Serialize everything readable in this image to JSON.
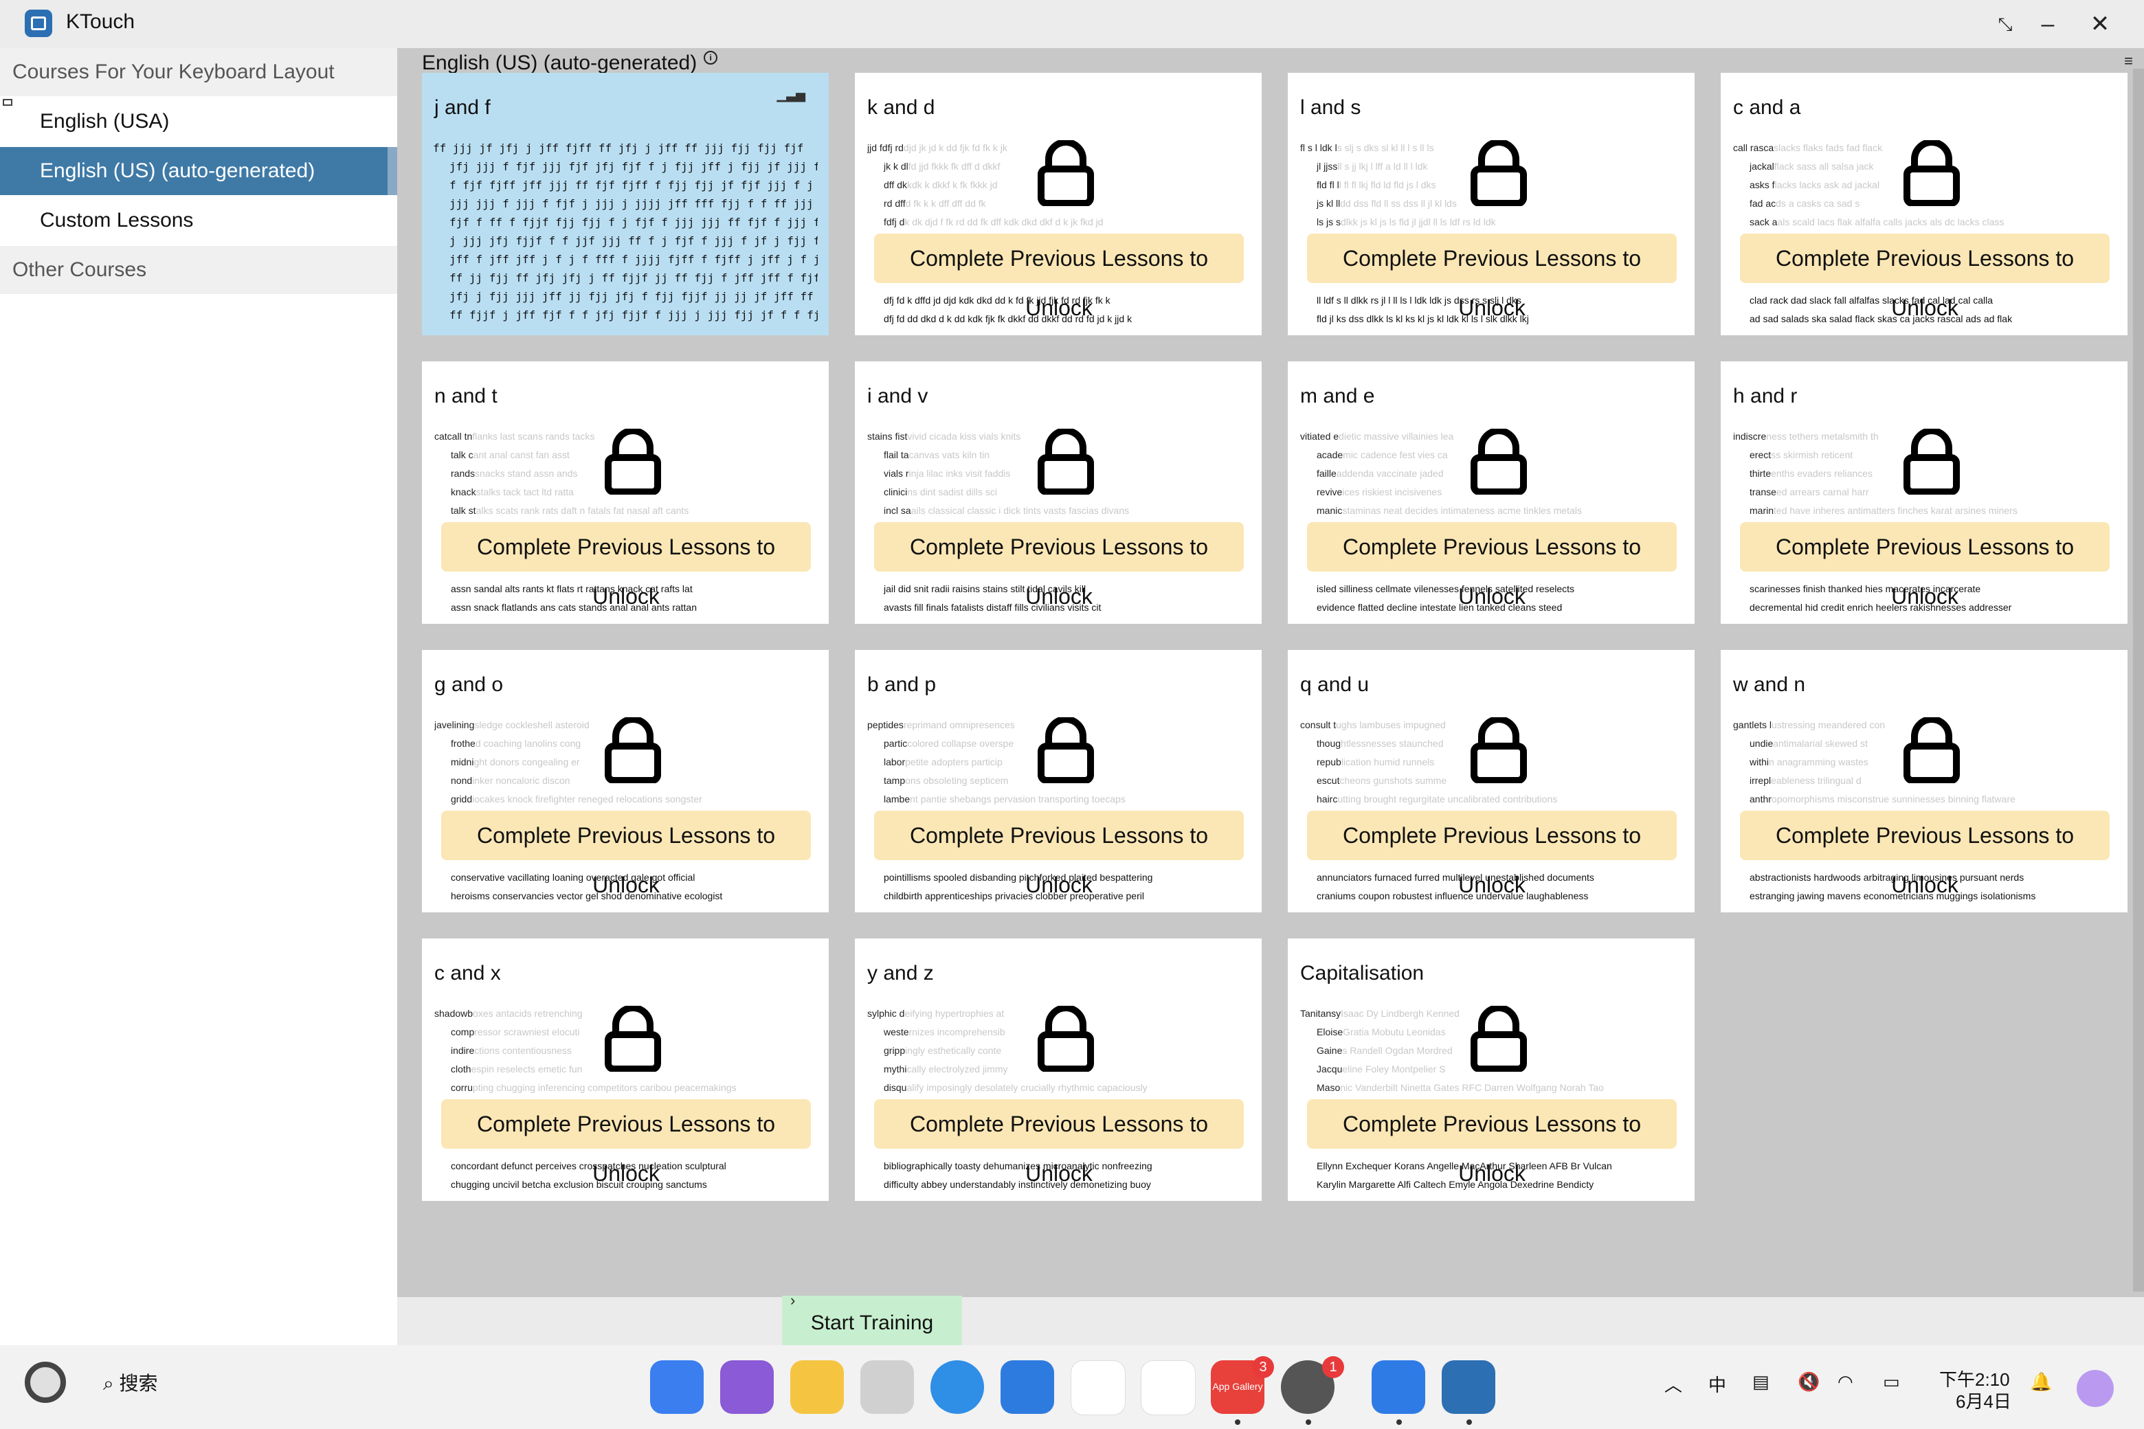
{
  "window": {
    "title": "KTouch"
  },
  "sidebar": {
    "header1": "Courses For Your Keyboard Layout",
    "items": [
      {
        "label": "English (USA)"
      },
      {
        "label": "English (US) (auto-generated)"
      },
      {
        "label": "Custom Lessons"
      }
    ],
    "header2": "Other Courses"
  },
  "main": {
    "course_title": "English (US) (auto-generated)",
    "unlock_label": "Complete Previous Lessons to Unlock",
    "start_training": "Start Training"
  },
  "lessons": [
    {
      "title": "j and f",
      "status": "unlocked",
      "lines": [
        "ff jjj jf jfj j jff fjff ff jfj j jff ff jjj fjj fjj fjf",
        "jfj jjj f fjf jjj fjf jfj fjf f j fjj jff j fjj jf jjj fjjf f",
        "f fjf fjff jff jjj ff fjf fjff f fjj fjj jf fjf jjj f j fjj",
        "jjj jjj f jjj f fjf j jjj j jjjj jff fff fjj f f ff jjj j",
        "fjf f ff f fjjf fjj fjj f j fjf f jjj jjj ff fjf f jjj fjj",
        "j jjj jfj fjjf f f jjf jjj ff f j fjf f jjj f jf j fjj fjjf jj",
        "jff f jff jff j f j f fff f jjjj fjff f fjff j jff j f jf j",
        "ff jj fjj ff jfj jfj j ff fjjf jj ff fjj f jff jff f fjf jj jf",
        "jfj j fjj jjj jff jj fjj jfj f fjj fjjf jj jj jf jff ff f jf jj",
        "ff fjjf j jff fjf f f jfj fjjf f jjj j jjj fjj jf f f fjj ff jjj"
      ]
    },
    {
      "title": "k and d",
      "status": "locked",
      "lead": [
        "jjd fdfj rd",
        "jk k dl",
        "dff dk",
        "rd dff",
        "fdfj d"
      ],
      "dim": [
        "djd jk jd k dd fjk fd fk k jk",
        "fd jjd fkkk fk dff d dkkf",
        "kdk k dkkf k fk fkkk jd",
        "d fk k k dff dff dd fk",
        "k dk djd f fk rd dd fk dff kdk dkd dkf d k jk fkd jd"
      ],
      "footer": [
        "dfj fd k dffd jd djd kdk dkd dd k fd fk jjd fjk fd rd fjk fk k",
        "dfj fd dd dkd d k dd kdk fjk fk dkkf dd dkkf dd rd fd jd k jjd k"
      ]
    },
    {
      "title": "l and s",
      "status": "locked",
      "lead": [
        "fl s l ldk l",
        "jl jjss",
        "fld fl l",
        "js kl ll",
        "ls js s"
      ],
      "dim": [
        "s slj s dks sl kl ll l s ll ls",
        "ll s jj lkj l lff a ld ll l ldk",
        "l fl fl lkj fld ld fld js l dks",
        "dd dss fld ll ss dss ll jl kl lds",
        "dlkk js kl js ls fld jl jjdl ll ls ldf rs ld ldk"
      ],
      "footer": [
        "ll ldf s ll dlkk rs jl l ll ls l ldk ldk js dss rs s slj l dks",
        "fld jl ks dss dlkk ls kl ks kl js kl ldk kl ls l slk dlkk lkj"
      ]
    },
    {
      "title": "c and a",
      "status": "locked",
      "lead": [
        "call rasca",
        "jackal",
        "asks f",
        "fad ac",
        "sack a"
      ],
      "dim": [
        "slacks flaks fads fad flack",
        "flack sass all salsa jack",
        "lacks lacks ask ad jackal",
        "ds a casks ca sad s",
        "als scald lacs flak alfalfa calls jacks als dc lacks class"
      ],
      "footer": [
        "clad rack dad slack fall alfalfas slacks fad cal lad cal calla",
        "ad sad salads ska salad flack skas ca jacks rascal ads ad flak"
      ]
    },
    {
      "title": "n and t",
      "status": "locked",
      "lead": [
        "catcall tn",
        "talk c",
        "rands",
        "knack",
        "talk st"
      ],
      "dim": [
        "flanks last scans rands tacks",
        "ant anal canst fan asst",
        "snacks stand assn ands",
        "stalks tack tact ltd ratta",
        "alks scats rank rats daft n fatals fat nasal aft cants"
      ],
      "footer": [
        "assn sandal alts rants kt flats rt rattans knack cat rafts lat",
        "assn snack flatlands ans cats stands anal anal ants rattan"
      ]
    },
    {
      "title": "i and v",
      "status": "locked",
      "lead": [
        "stains fist",
        "flail ta",
        "vials r",
        "clinici",
        "incl sa"
      ],
      "dim": [
        "vivid cicada kiss vials knits",
        "canvas vats kiln tin",
        "inja lilac inks visit faddis",
        "ns dint sadist dills sci",
        "ails classical classic i dick tints vasts fascias divans"
      ],
      "footer": [
        "jail did snit radii raisins stains stilt tidal cavils kill",
        "avasts fill finals fatalists distaff fills civilians visits cit"
      ]
    },
    {
      "title": "m and e",
      "status": "locked",
      "lead": [
        "vitiated e",
        "acade",
        "faille",
        "revive",
        "manic"
      ],
      "dim": [
        "dietic massive villainies lea",
        "mic cadence fest vies ca",
        "addenda vaccinate jaded",
        "ices riskiest incisivenes",
        "staminas neat decides intimateness acme tinkles metals"
      ],
      "footer": [
        "isled silliness cellmate vilenesses fennels satellited reselects",
        "evidence flatted decline intestate lien tanked cleans steed"
      ]
    },
    {
      "title": "h and r",
      "status": "locked",
      "lead": [
        "indiscre",
        "erect",
        "thirte",
        "transe",
        "marin"
      ],
      "dim": [
        "ness tethers metalsmith th",
        "ss skirmish reticent",
        "enths evaders reliances",
        "ed arrears carnal harr",
        "ted have inheres antimatters finches karat arsines miners"
      ],
      "footer": [
        "scarinesses finish thanked hies macerates incarcerate",
        "decremental hid credit enrich heelers rakishnesses addresser"
      ]
    },
    {
      "title": "g and o",
      "status": "locked",
      "lead": [
        "javelining",
        "frothe",
        "midni",
        "nond",
        "gridd"
      ],
      "dim": [
        "sledge cockleshell asteroid",
        "d coaching lanolins cong",
        "ght donors congealing er",
        "inker noncaloric discon",
        "iocakes knock firefighter reneged relocations songster"
      ],
      "footer": [
        "conservative vacillating loaning overacted gale got official",
        "heroisms conservancies vector gel shod denominative ecologist"
      ]
    },
    {
      "title": "b and p",
      "status": "locked",
      "lead": [
        "peptides",
        "partic",
        "labor",
        "tamp",
        "lambe"
      ],
      "dim": [
        "reprimand omnipresences",
        "colored collapse overspe",
        "petite adopters particip",
        "ons obsoleting septicem",
        "nt pantie shebangs pervasion transporting toecaps"
      ],
      "footer": [
        "pointillisms spooled disbanding pitchforked plaited bespattering",
        "childbirth apprenticeships privacies clobber preoperative peril"
      ]
    },
    {
      "title": "q and u",
      "status": "locked",
      "lead": [
        "consult t",
        "thoug",
        "repub",
        "escut",
        "hairc"
      ],
      "dim": [
        "ughs lambuses impugned",
        "htlessnesses staunched",
        "lication humid runnels",
        "cheons gunshots summe",
        "utting brought regurgitate uncalibrated contributions"
      ],
      "footer": [
        "annunciators furnaced furred multilevel unestablished documents",
        "craniums coupon robustest influence undervalue laughableness"
      ]
    },
    {
      "title": "w and n",
      "status": "locked",
      "lead": [
        "gantlets l",
        "undie",
        "withi",
        "irrepl",
        "anthr"
      ],
      "dim": [
        "ustressing meandered con",
        "antimalarial skewed st",
        "n anagramming wastes",
        "eableness trilingual d",
        "opomorphisms misconstrue sunninesses binning flatware"
      ],
      "footer": [
        "abstractionists hardwoods arbitraging limousines pursuant nerds",
        "estranging jawing mavens econometricians muggings isolationisms"
      ]
    },
    {
      "title": "c and x",
      "status": "locked",
      "lead": [
        "shadowb",
        "comp",
        "indire",
        "cloth",
        "corru"
      ],
      "dim": [
        "oxes antacids retrenching",
        "ressor scrawniest elocuti",
        "ctions contentiousness",
        "espin reselects emetic fun",
        "pting chugging inferencing competitors caribou peacemakings"
      ],
      "footer": [
        "concordant defunct perceives crosspatches nucleation sculptural",
        "chugging uncivil betcha exclusion biscuit crouping sanctums"
      ]
    },
    {
      "title": "y and z",
      "status": "locked",
      "lead": [
        "sylphic d",
        "weste",
        "gripp",
        "mythi",
        "disqu"
      ],
      "dim": [
        "eifying hypertrophies at",
        "rnizes incomprehensib",
        "ingly esthetically conte",
        "cally electrolyzed jimmy",
        "alify imposingly desolately crucially rhythmic capaciously"
      ],
      "footer": [
        "bibliographically toasty dehumanizes microanalytic nonfreezing",
        "difficulty abbey understandably instinctively demonetizing buoy"
      ]
    },
    {
      "title": "Capitalisation",
      "status": "locked",
      "lead": [
        "Tanitansy",
        "Eloise",
        "Gaine",
        "Jacqu",
        "Maso"
      ],
      "dim": [
        "Isaac Dy Lindbergh Kenned",
        "Gratia Mobutu Leonidas",
        "s Randell Ogdan Mordred",
        "eline Foley Montpelier S",
        "nic Vanderbilt Ninetta Gates RFC Darren Wolfgang Norah Tao"
      ],
      "footer": [
        "Ellynn Exchequer Korans Angelle MacArthur Sharleen AFB Br Vulcan",
        "Karylin Margarette Alfi Caltech Emyle Angola Dexedrine Bendicty"
      ]
    }
  ],
  "taskbar": {
    "search_label": "搜索",
    "app_gallery_label": "App Gallery",
    "app_gallery_badge": "3",
    "settings_badge": "1",
    "ime_label": "中",
    "time": "下午2:10",
    "date": "6月4日"
  },
  "colors": {
    "accent": "#3f7aa6",
    "active_card": "#b9def2",
    "unlock_bg": "#fbe7b5",
    "start_bg": "#c7efcf"
  }
}
